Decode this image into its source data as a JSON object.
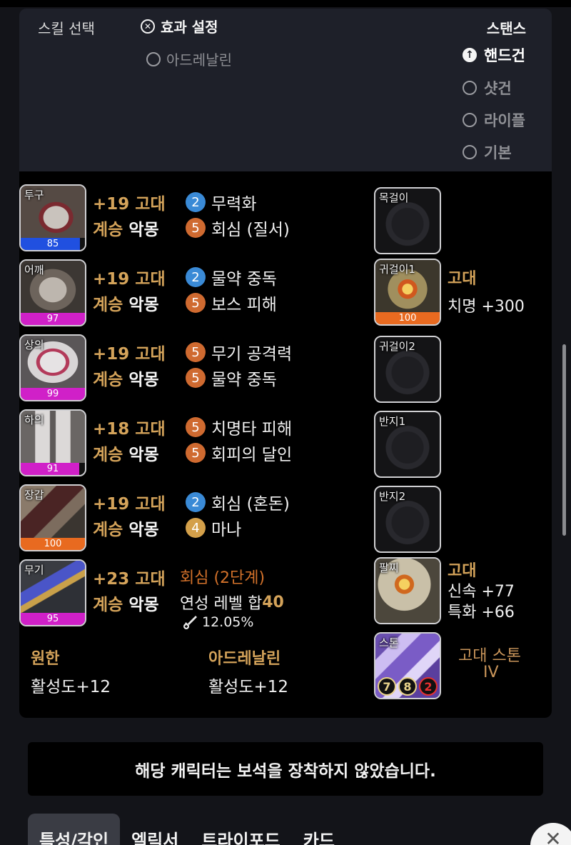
{
  "skill_panel": {
    "skill_select_label": "스킬 선택",
    "effect_setting_label": "효과 설정",
    "adrenaline_option": "아드레날린",
    "stance_title": "스탠스",
    "stances": [
      "핸드건",
      "샷건",
      "라이플",
      "기본"
    ],
    "selected_stance": "핸드건"
  },
  "armor": [
    {
      "slot": "투구",
      "quality": "85",
      "grade": "+19 고대",
      "tier_label": "계승",
      "set": "악몽",
      "effects": [
        {
          "level": "2",
          "name": "무력화"
        },
        {
          "level": "5",
          "name": "회심 (질서)"
        }
      ]
    },
    {
      "slot": "어깨",
      "quality": "97",
      "grade": "+19 고대",
      "tier_label": "계승",
      "set": "악몽",
      "effects": [
        {
          "level": "2",
          "name": "물약 중독"
        },
        {
          "level": "5",
          "name": "보스 피해"
        }
      ]
    },
    {
      "slot": "상의",
      "quality": "99",
      "grade": "+19 고대",
      "tier_label": "계승",
      "set": "악몽",
      "effects": [
        {
          "level": "5",
          "name": "무기 공격력"
        },
        {
          "level": "5",
          "name": "물약 중독"
        }
      ]
    },
    {
      "slot": "하의",
      "quality": "91",
      "grade": "+18 고대",
      "tier_label": "계승",
      "set": "악몽",
      "effects": [
        {
          "level": "5",
          "name": "치명타 피해"
        },
        {
          "level": "5",
          "name": "회피의 달인"
        }
      ]
    },
    {
      "slot": "장갑",
      "quality": "100",
      "grade": "+19 고대",
      "tier_label": "계승",
      "set": "악몽",
      "effects": [
        {
          "level": "2",
          "name": "회심 (혼돈)"
        },
        {
          "level": "4",
          "name": "마나"
        }
      ]
    }
  ],
  "weapon": {
    "slot": "무기",
    "quality": "95",
    "grade": "+23 고대",
    "tier_label": "계승",
    "set": "악몽",
    "effect": "회심 (2단계)",
    "refine_label": "연성 레벨 합",
    "refine_value": "40",
    "percent": "12.05%"
  },
  "bracelet_bonus": [
    {
      "title": "원한",
      "value": "활성도+12"
    },
    {
      "title": "아드레날린",
      "value": "활성도+12"
    }
  ],
  "accessories": [
    {
      "slot": "목걸이"
    },
    {
      "slot": "귀걸이1",
      "quality": "100",
      "grade": "고대",
      "stat": "치명 +300"
    },
    {
      "slot": "귀걸이2"
    },
    {
      "slot": "반지1"
    },
    {
      "slot": "반지2"
    }
  ],
  "bracelet": {
    "slot": "팔찌",
    "grade": "고대",
    "stats": [
      "신속 +77",
      "특화 +66"
    ]
  },
  "stone": {
    "slot": "스톤",
    "name": "고대 스톤",
    "tier": "IV",
    "values": [
      "7",
      "8",
      "2"
    ]
  },
  "notice": "해당 캐릭터는 보석을 장착하지 않았습니다.",
  "tabs": [
    "특성/각인",
    "엘릭서",
    "트라이포드",
    "카드"
  ],
  "colors": {
    "gold": "#d4a35a",
    "effect_blue": "#3a8ad6",
    "effect_orange": "#cf6a30",
    "quality_pink": "#d020c8",
    "quality_orange": "#e86a20",
    "quality_blue": "#2050e0"
  }
}
